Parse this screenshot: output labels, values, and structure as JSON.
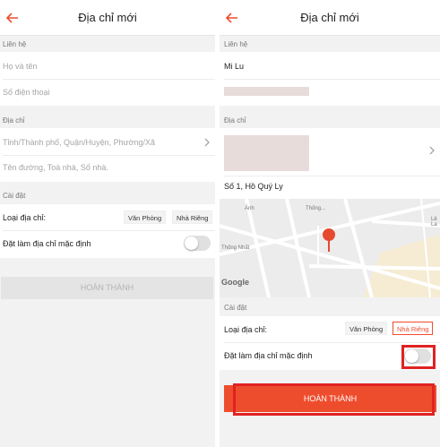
{
  "left": {
    "title": "Địa chỉ mới",
    "section_contact": "Liên hệ",
    "name_placeholder": "Họ và tên",
    "phone_placeholder": "Số điện thoại",
    "section_address": "Địa chỉ",
    "region_placeholder": "Tỉnh/Thành phố, Quận/Huyện, Phường/Xã",
    "street_placeholder": "Tên đường, Toà nhà, Số nhà.",
    "section_settings": "Cài đặt",
    "address_type_label": "Loại địa chỉ:",
    "type_office": "Văn Phòng",
    "type_home": "Nhà Riêng",
    "default_label": "Đặt làm địa chỉ mặc định",
    "default_on": false,
    "submit_label": "HOÀN THÀNH"
  },
  "right": {
    "title": "Địa chỉ mới",
    "section_contact": "Liên hệ",
    "name_value": "Mi Lu",
    "section_address": "Địa chỉ",
    "street_value": "Số 1, Hồ Quý Ly",
    "map_labels": {
      "street_a": "Thống...",
      "street_b": "Thống Nhất",
      "street_c": "Lê La",
      "street_d": "Ánh"
    },
    "map_brand": "Google",
    "section_settings": "Cài đặt",
    "address_type_label": "Loại địa chỉ:",
    "type_office": "Văn Phòng",
    "type_home": "Nhà Riêng",
    "selected_type": "Nhà Riêng",
    "default_label": "Đặt làm địa chỉ mặc định",
    "default_on": false,
    "submit_label": "HOÀN THÀNH"
  },
  "colors": {
    "accent": "#ee4d2d",
    "highlight": "#e02222"
  }
}
